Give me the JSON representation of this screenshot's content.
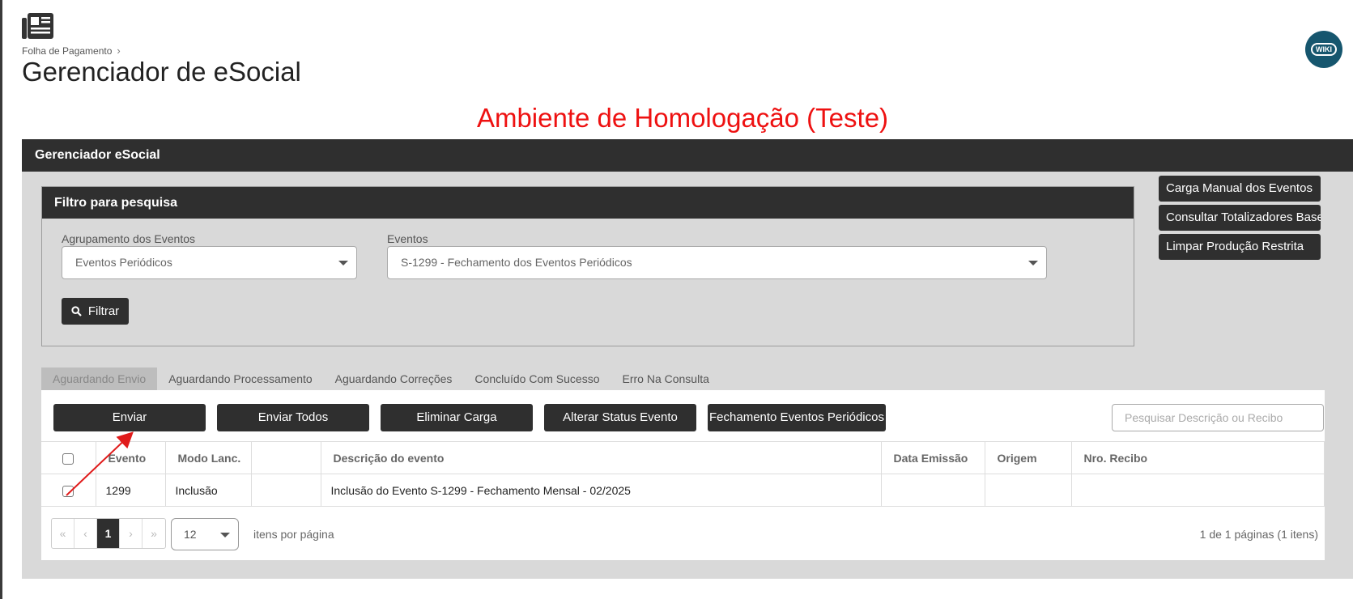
{
  "breadcrumb": {
    "parent": "Folha de Pagamento"
  },
  "page_title": "Gerenciador de eSocial",
  "wiki_label": "WIKI",
  "environment_banner": "Ambiente de Homologação (Teste)",
  "panel": {
    "title": "Gerenciador eSocial"
  },
  "filter": {
    "title": "Filtro para pesquisa",
    "group_label": "Agrupamento dos Eventos",
    "group_value": "Eventos Periódicos",
    "events_label": "Eventos",
    "events_value": "S-1299 - Fechamento dos Eventos Periódicos",
    "filter_button": "Filtrar"
  },
  "side_buttons": [
    "Carga Manual dos Eventos",
    "Consultar Totalizadores Base",
    "Limpar Produção Restrita"
  ],
  "tabs": [
    "Aguardando Envio",
    "Aguardando Processamento",
    "Aguardando Correções",
    "Concluído Com Sucesso",
    "Erro Na Consulta"
  ],
  "actions": [
    "Enviar",
    "Enviar Todos",
    "Eliminar Carga",
    "Alterar Status Evento",
    "Fechamento Eventos Periódicos"
  ],
  "search": {
    "placeholder": "Pesquisar Descrição ou Recibo"
  },
  "table": {
    "columns": [
      "",
      "Evento",
      "Modo Lanc.",
      "",
      "Descrição do evento",
      "Data Emissão",
      "Origem",
      "Nro. Recibo"
    ],
    "rows": [
      {
        "evento": "1299",
        "modo": "Inclusão",
        "extra": "",
        "descricao": "Inclusão do Evento S-1299 - Fechamento Mensal - 02/2025",
        "data": "",
        "origem": "",
        "recibo": ""
      }
    ]
  },
  "pagination": {
    "first": "«",
    "prev": "‹",
    "current": "1",
    "next": "›",
    "last": "»",
    "per_page": "12",
    "per_page_label": "itens por página",
    "info": "1 de 1 páginas (1 itens)"
  },
  "colors": {
    "dark": "#2f2f2f",
    "banner": "#ee1111",
    "panel_bg": "#d9d9d9",
    "wiki": "#16566e",
    "arrow": "#e01b1b"
  }
}
